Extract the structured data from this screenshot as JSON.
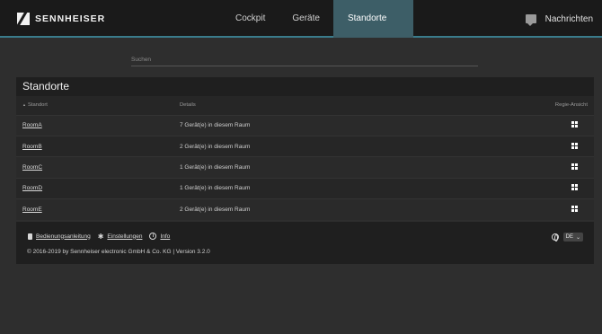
{
  "header": {
    "brand": "SENNHEISER",
    "nav": [
      "Cockpit",
      "Geräte",
      "Standorte"
    ],
    "active_nav": "Standorte",
    "messages_label": "Nachrichten"
  },
  "search": {
    "placeholder": "Suchen"
  },
  "panel": {
    "title": "Standorte",
    "columns": {
      "location": "Standort",
      "details": "Details",
      "director_view": "Regie-Ansicht"
    },
    "rows": [
      {
        "room": "RoomA",
        "details": "7 Gerät(e) in diesem Raum"
      },
      {
        "room": "RoomB",
        "details": "2 Gerät(e) in diesem Raum"
      },
      {
        "room": "RoomC",
        "details": "1 Gerät(e) in diesem Raum"
      },
      {
        "room": "RoomD",
        "details": "1 Gerät(e) in diesem Raum"
      },
      {
        "room": "RoomE",
        "details": "2 Gerät(e) in diesem Raum"
      }
    ]
  },
  "footer": {
    "manual": "Bedienungsanleitung",
    "settings": "Einstellungen",
    "info": "Info",
    "copyright": "© 2016-2019 by Sennheiser electronic GmbH & Co. KG | Version 3.2.0",
    "language": "DE"
  },
  "colors": {
    "accent": "#3a7c8c",
    "active_tab": "#3d5e67",
    "background": "#2e2e2e"
  }
}
